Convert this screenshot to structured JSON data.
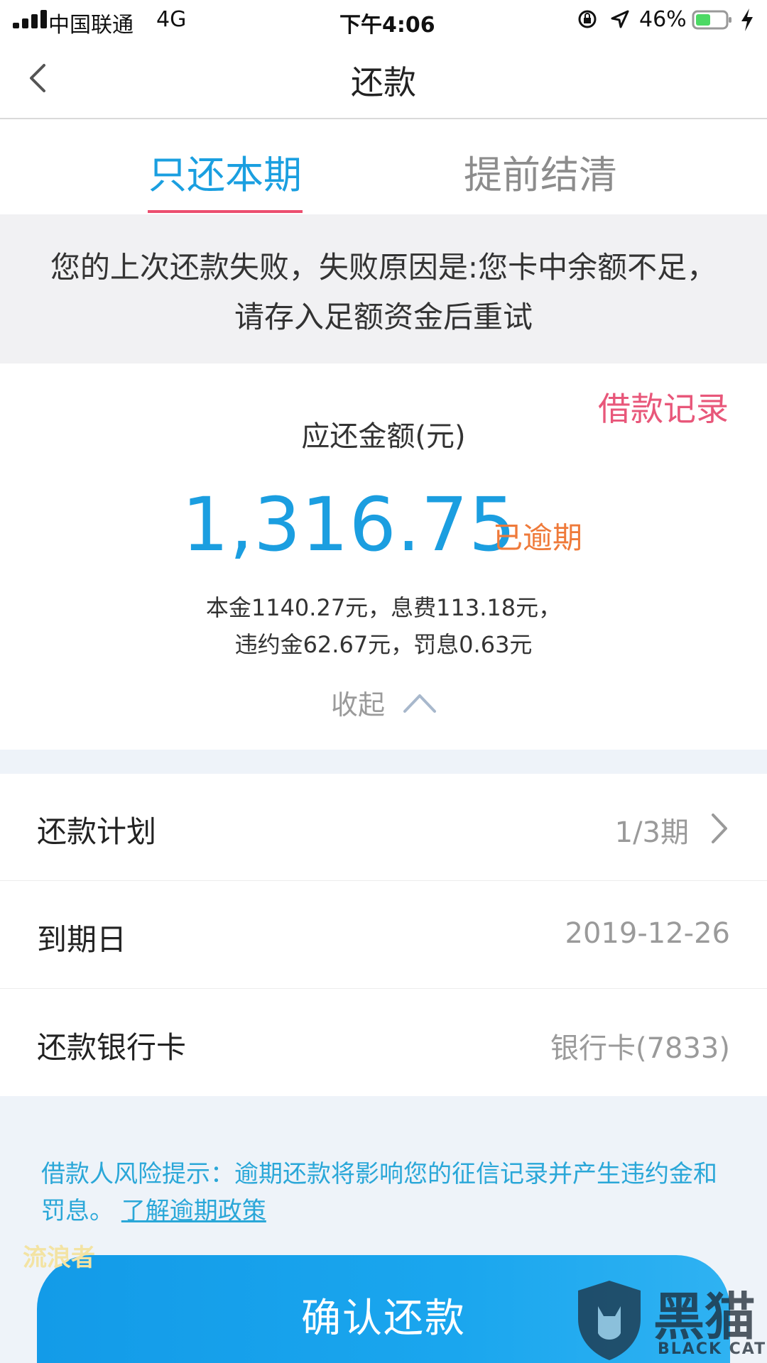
{
  "status_bar": {
    "carrier": "中国联通",
    "network": "4G",
    "time": "下午4:06",
    "battery": "46%"
  },
  "nav": {
    "title": "还款"
  },
  "tabs": [
    {
      "label": "只还本期",
      "active": true
    },
    {
      "label": "提前结清",
      "active": false
    }
  ],
  "notice": {
    "text": "您的上次还款失败，失败原因是:您卡中余额不足，请存入足额资金后重试"
  },
  "amount_card": {
    "loan_record": "借款记录",
    "label": "应还金额(元)",
    "value": "1,316.75",
    "status": "已逾期",
    "breakdown_line1": "本金1140.27元，息费113.18元，",
    "breakdown_line2": "违约金62.67元，罚息0.63元",
    "collapse": "收起"
  },
  "list": [
    {
      "label": "还款计划",
      "value": "1/3期"
    },
    {
      "label": "到期日",
      "value": "2019-12-26"
    },
    {
      "label": "还款银行卡",
      "value": "银行卡(7833)"
    }
  ],
  "risk": {
    "text": "借款人风险提示：逾期还款将影响您的征信记录并产生违约金和罚息。",
    "link": "了解逾期政策"
  },
  "confirm_button": {
    "label": "确认还款"
  },
  "watermarks": {
    "left": "流浪者",
    "right_big": "黑猫",
    "right_small": "BLACK CAT"
  },
  "colors": {
    "accent_blue": "#1a9fe0",
    "pink": "#e8577a",
    "overdue_orange": "#ef7a3a",
    "tab_underline": "#ec4f6f"
  }
}
